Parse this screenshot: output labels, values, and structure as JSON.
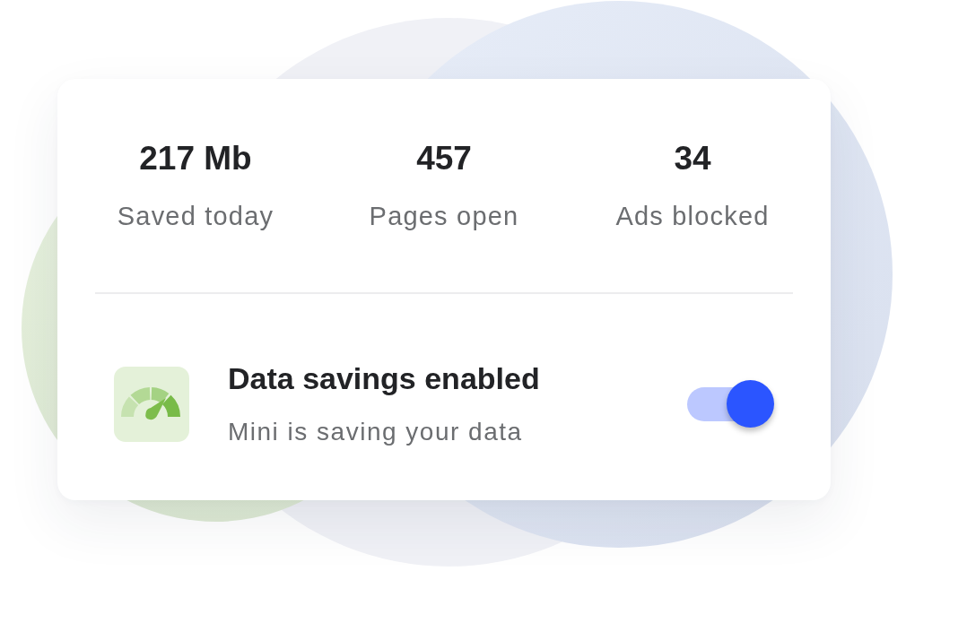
{
  "stats": [
    {
      "value": "217 Mb",
      "label": "Saved today"
    },
    {
      "value": "457",
      "label": "Pages open"
    },
    {
      "value": "34",
      "label": "Ads blocked"
    }
  ],
  "setting": {
    "title": "Data savings enabled",
    "subtitle": "Mini is saving your data",
    "on": true
  }
}
